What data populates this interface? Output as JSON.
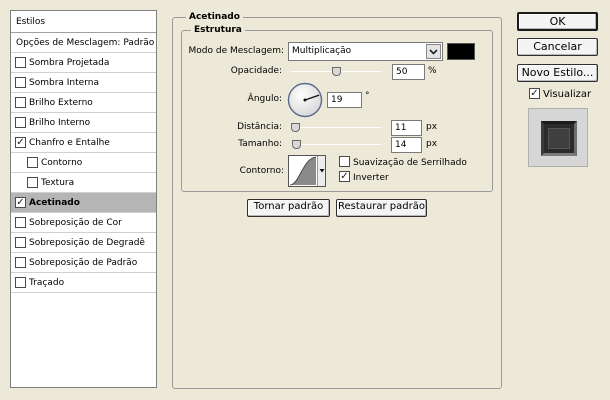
{
  "styles_panel": {
    "header": "Estilos",
    "blend_options": "Opções de Mesclagem: Padrão",
    "items": [
      {
        "label": "Sombra Projetada",
        "checked": false,
        "indent": 0,
        "selected": false
      },
      {
        "label": "Sombra Interna",
        "checked": false,
        "indent": 0,
        "selected": false
      },
      {
        "label": "Brilho Externo",
        "checked": false,
        "indent": 0,
        "selected": false
      },
      {
        "label": "Brilho Interno",
        "checked": false,
        "indent": 0,
        "selected": false
      },
      {
        "label": "Chanfro e Entalhe",
        "checked": true,
        "indent": 0,
        "selected": false
      },
      {
        "label": "Contorno",
        "checked": false,
        "indent": 1,
        "selected": false
      },
      {
        "label": "Textura",
        "checked": false,
        "indent": 1,
        "selected": false
      },
      {
        "label": "Acetinado",
        "checked": true,
        "indent": 0,
        "selected": true
      },
      {
        "label": "Sobreposição de Cor",
        "checked": false,
        "indent": 0,
        "selected": false
      },
      {
        "label": "Sobreposição de Degradê",
        "checked": false,
        "indent": 0,
        "selected": false
      },
      {
        "label": "Sobreposição de Padrão",
        "checked": false,
        "indent": 0,
        "selected": false
      },
      {
        "label": "Traçado",
        "checked": false,
        "indent": 0,
        "selected": false
      }
    ]
  },
  "satin": {
    "title": "Acetinado",
    "structure_title": "Estrutura",
    "blend_mode_label": "Modo de Mesclagem:",
    "blend_mode_value": "Multiplicação",
    "blend_color": "#000000",
    "opacity_label": "Opacidade:",
    "opacity_value": "50",
    "opacity_unit": "%",
    "opacity_fraction": 0.5,
    "angle_label": "Ângulo:",
    "angle_value": "19",
    "angle_unit": "°",
    "distance_label": "Distância:",
    "distance_value": "11",
    "distance_unit": "px",
    "distance_fraction": 0.04,
    "size_label": "Tamanho:",
    "size_value": "14",
    "size_unit": "px",
    "size_fraction": 0.05,
    "contour_label": "Contorno:",
    "antialias_label": "Suavização de Serrilhado",
    "antialias_checked": false,
    "invert_label": "Inverter",
    "invert_checked": true,
    "reset_default": "Tornar padrão",
    "restore_default": "Restaurar padrão"
  },
  "buttons": {
    "ok": "OK",
    "cancel": "Cancelar",
    "new_style": "Novo Estilo...",
    "preview_label": "Visualizar",
    "preview_checked": true
  }
}
